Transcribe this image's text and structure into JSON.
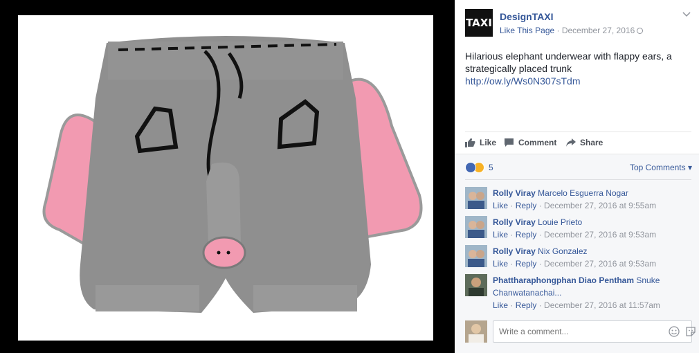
{
  "post": {
    "page_name": "DesignTAXI",
    "logo_text": "TAXI",
    "like_page": "Like This Page",
    "meta_sep": " · ",
    "date": "December 27, 2016",
    "text_line1": "Hilarious elephant underwear with flappy ears, a",
    "text_line2": "strategically placed trunk",
    "link": "http://ow.ly/Ws0N307sTdm"
  },
  "actions": {
    "like": "Like",
    "comment": "Comment",
    "share": "Share"
  },
  "reactions": {
    "count": "5",
    "types": [
      "like-icon",
      "haha-icon"
    ],
    "top_comments": "Top Comments"
  },
  "comments": [
    {
      "author": "Rolly Viray",
      "tagged": "Marcelo Esguerra Nogar",
      "tagged_line2": "",
      "like": "Like",
      "reply": "Reply",
      "sep": " · ",
      "time": "December 27, 2016 at 9:55am"
    },
    {
      "author": "Rolly Viray",
      "tagged": "Louie Prieto",
      "tagged_line2": "",
      "like": "Like",
      "reply": "Reply",
      "sep": " · ",
      "time": "December 27, 2016 at 9:53am"
    },
    {
      "author": "Rolly Viray",
      "tagged": "Nix Gonzalez",
      "tagged_line2": "",
      "like": "Like",
      "reply": "Reply",
      "sep": " · ",
      "time": "December 27, 2016 at 9:53am"
    },
    {
      "author": "Phattharaphongphan Diao Pentham",
      "tagged": "Snuke",
      "tagged_line2": "Chanwatanachai...",
      "like": "Like",
      "reply": "Reply",
      "sep": " · ",
      "time": "December 27, 2016 at 11:57am"
    }
  ],
  "composer": {
    "placeholder": "Write a comment..."
  },
  "colors": {
    "link": "#365899",
    "meta": "#90949c",
    "knit_gray": "#8d8d8d",
    "ear_pink": "#f39bb0"
  }
}
